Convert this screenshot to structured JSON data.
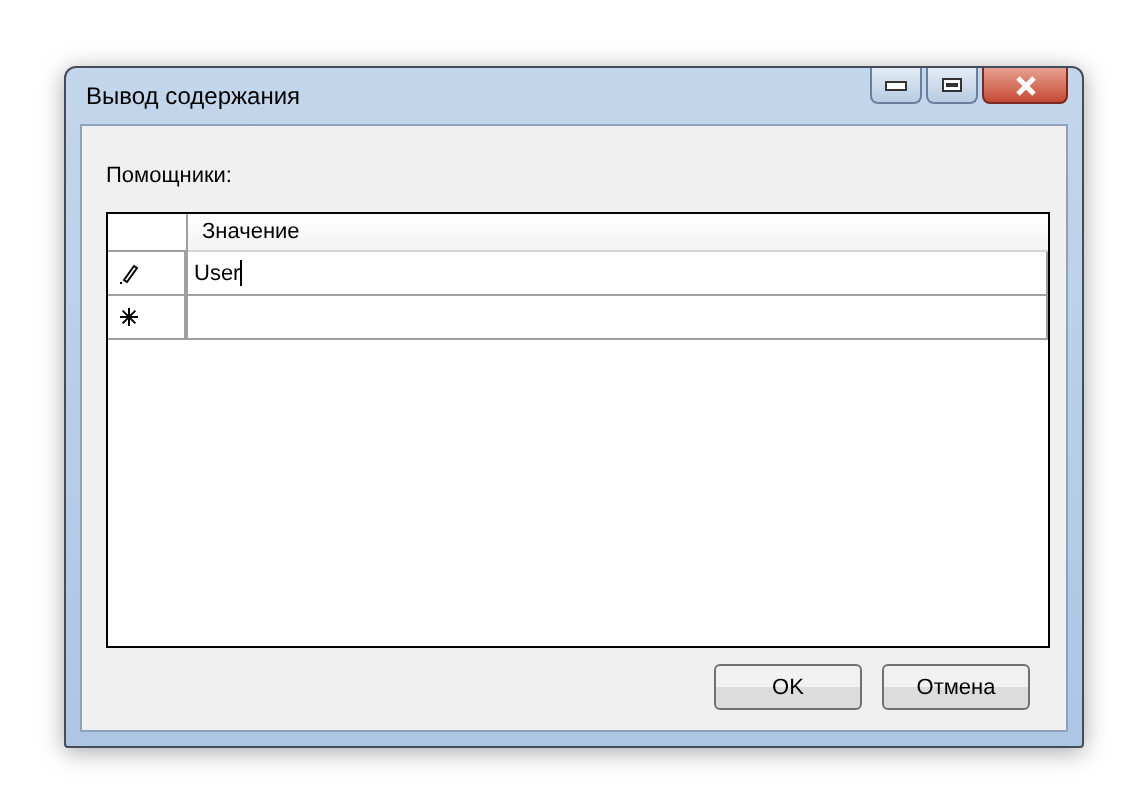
{
  "window": {
    "title": "Вывод содержания"
  },
  "label": "Помощники:",
  "grid": {
    "columns": [
      "Значение"
    ],
    "rows": [
      {
        "kind": "edit",
        "value": "User"
      },
      {
        "kind": "new",
        "value": ""
      }
    ]
  },
  "buttons": [
    "OK",
    "Отмена"
  ]
}
